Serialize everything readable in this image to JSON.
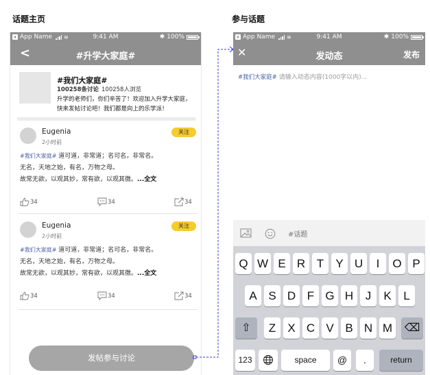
{
  "left_section_title": "话题主页",
  "right_section_title": "参与话题",
  "status_bar": {
    "carrier": "App Name",
    "time": "9:41 AM",
    "battery": "100%"
  },
  "topic_page": {
    "back_glyph": "<",
    "nav_title": "#升学大家庭#",
    "topic": {
      "name": "#我们大家庭#",
      "discussions": "100258条讨论",
      "views": "100258人浏览",
      "description": "升学的老师们，你们辛苦了！欢迎加入升学大家庭，快来发帖讨论吧！我们都是向上的乐学派！"
    },
    "posts": [
      {
        "author": "Eugenia",
        "time": "2小时前",
        "follow_label": "关注",
        "hashtag": "#我们大家庭#",
        "line1": "道可道，非常道；名可名，非常名。",
        "line2": "无名，天地之始，有名，万物之母。",
        "line3": "故常无欲，以观其妙，常有欲，以观其徼。",
        "more_label": "...全文",
        "likes": "34",
        "comments": "34",
        "shares": "34"
      },
      {
        "author": "Eugenia",
        "time": "2小时前",
        "follow_label": "关注",
        "hashtag": "#我们大家庭#",
        "line1": "道可道，非常道；名可名，非常名。",
        "line2": "无名，天地之始，有名，万物之母。",
        "line3": "故常无欲，以观其妙，常有欲，以观其徼。",
        "more_label": "...全文",
        "likes": "34",
        "comments": "34",
        "shares": "34"
      }
    ],
    "join_button_label": "发帖参与讨论"
  },
  "compose_page": {
    "close_glyph": "✕",
    "nav_title": "发动态",
    "publish_label": "发布",
    "hashtag": "#我们大家庭#",
    "placeholder": "请输入动态内容(1000字以内)...",
    "toolbar_topic_label": "#话题"
  },
  "keyboard": {
    "row1": [
      "Q",
      "W",
      "E",
      "R",
      "T",
      "Y",
      "U",
      "I",
      "O",
      "P"
    ],
    "row2": [
      "A",
      "S",
      "D",
      "F",
      "G",
      "H",
      "J",
      "K",
      "L"
    ],
    "row3": [
      "Z",
      "X",
      "C",
      "V",
      "B",
      "N",
      "M"
    ],
    "numbers_label": "123",
    "space_label": "space",
    "at_label": "@",
    "period_label": ".",
    "return_label": "return",
    "shift_glyph": "⇧",
    "delete_glyph": "⌫"
  },
  "colors": {
    "nav_gray": "#8f8f8f",
    "follow_yellow": "#f5cc2e",
    "hashtag_blue": "#4a5fa8",
    "connector_blue": "#3a3adf",
    "keyboard_bg": "#d1d3d8"
  },
  "icons": {
    "like": "thumbs-up-icon",
    "comment": "comment-bubble-icon",
    "share": "share-icon",
    "image": "image-icon",
    "emoji": "emoji-icon",
    "globe": "globe-icon"
  }
}
